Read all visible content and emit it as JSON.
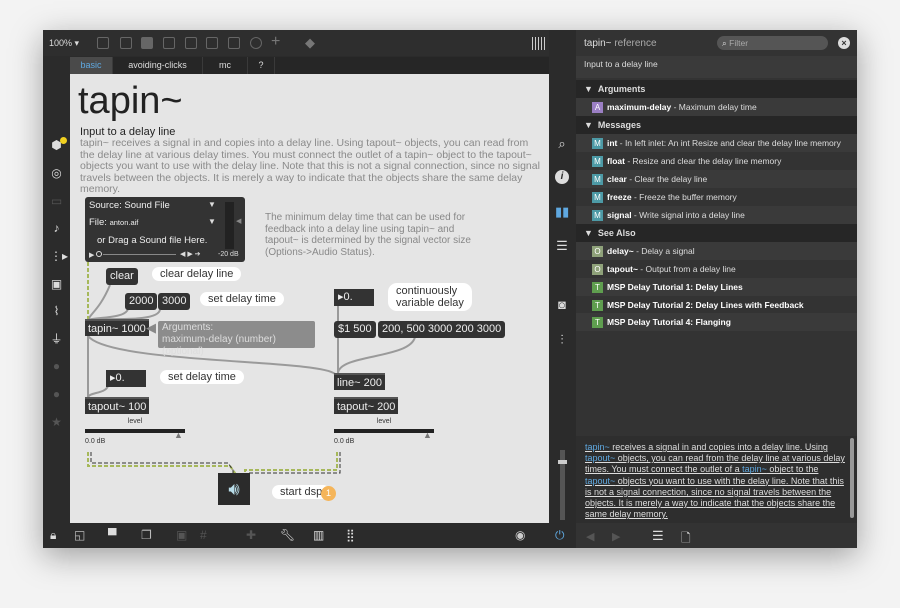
{
  "toolbar": {
    "zoom": "100%"
  },
  "tabs": [
    "basic",
    "avoiding-clicks",
    "mc",
    "?"
  ],
  "patch": {
    "title": "tapin~",
    "subtitle": "Input to a delay line",
    "description": "tapin~ receives a signal in and copies into a delay line. Using tapout~ objects, you can read from the delay line at various delay times. You must connect the outlet of a tapin~ object to the tapout~ objects you want to use with the delay line. Note that this is not a signal connection, since no signal travels between the objects. It is merely a way to indicate that the objects share the same delay memory.",
    "player": {
      "source": "Source: Sound File",
      "file_label": "File:",
      "file": "anton.aif",
      "drag": "or Drag a Sound file Here.",
      "gain": "-20 dB"
    },
    "note": "The minimum delay time that can be used for feedback into a delay line using tapin~ and tapout~ is determined by the signal vector size (Options->Audio Status).",
    "clear_msg": "clear",
    "clear_comment": "clear delay line",
    "msg_2000": "2000",
    "msg_3000": "3000",
    "set_delay_1": "set delay time",
    "tapin_obj": "tapin~ 1000",
    "args_title": "Arguments:",
    "args_text": "maximum-delay (number) (optional)",
    "num_right": "0.",
    "cont_comment_1": "continuously",
    "cont_comment_2": "variable delay",
    "msg_1_500": "$1 500",
    "msg_list": "200, 500 3000 200 3000",
    "num_left": "0.",
    "set_delay_2": "set delay time",
    "line_obj": "line~ 200",
    "tapout_100": "tapout~ 100",
    "tapout_200": "tapout~ 200",
    "level_label": "level",
    "level_value": "0.0 dB",
    "level_fraction": 0.93,
    "start_dsp": "start dsp",
    "step_badge": "1"
  },
  "reference": {
    "title": "tapin~",
    "title_suffix": "reference",
    "filter_placeholder": "Filter",
    "digest": "Input to a delay line",
    "sections": {
      "arguments": "Arguments",
      "messages": "Messages",
      "see_also": "See Also"
    },
    "arguments": [
      {
        "badge": "A",
        "name": "maximum-delay",
        "desc": " - Maximum delay time"
      }
    ],
    "messages": [
      {
        "badge": "M",
        "name": "int",
        "desc": " - In left inlet: An int Resize and clear the delay line memory"
      },
      {
        "badge": "M",
        "name": "float",
        "desc": " - Resize and clear the delay line memory"
      },
      {
        "badge": "M",
        "name": "clear",
        "desc": " - Clear the delay line"
      },
      {
        "badge": "M",
        "name": "freeze",
        "desc": " - Freeze the buffer memory"
      },
      {
        "badge": "M",
        "name": "signal",
        "desc": " - Write signal into a delay line"
      }
    ],
    "see_also": [
      {
        "badge": "O",
        "name": "delay~",
        "desc": " - Delay a signal"
      },
      {
        "badge": "O",
        "name": "tapout~",
        "desc": " - Output from a delay line"
      },
      {
        "badge": "T",
        "name": "MSP Delay Tutorial 1: Delay Lines",
        "desc": ""
      },
      {
        "badge": "T",
        "name": "MSP Delay Tutorial 2: Delay Lines with Feedback",
        "desc": ""
      },
      {
        "badge": "T",
        "name": "MSP Delay Tutorial 4: Flanging",
        "desc": ""
      }
    ],
    "body": {
      "l1": "tapin~",
      "t1": " receives a signal in and copies into a delay line. Using ",
      "l2": "tapout~",
      "t2": " objects, you can read from the delay line at various delay times. You must connect the outlet of a ",
      "l3": "tapin~",
      "t3": " object to the ",
      "l4": "tapout~",
      "t4": " objects you want to use with the delay line. Note that this is not a signal connection, since no signal travels between the objects. It is merely a way to indicate that the objects share the same delay memory."
    }
  },
  "colors": {
    "arg": "#9b7fc4",
    "msg": "#4d9aa6",
    "obj": "#8fa27a",
    "tut": "#5f9e4f",
    "badge": "#f5b55a",
    "link": "#5fa8e0"
  }
}
